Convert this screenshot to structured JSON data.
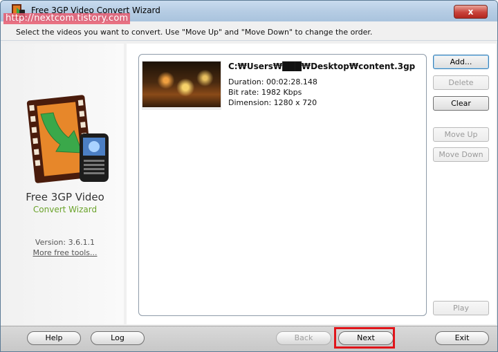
{
  "window": {
    "title": "Free 3GP Video Convert Wizard",
    "close_label": "x",
    "watermark": "http://nextcom.tistory.com"
  },
  "instruction": "Select the videos you want to convert. Use \"Move Up\" and \"Move Down\" to change the order.",
  "sidebar": {
    "brand_line1": "Free 3GP Video",
    "brand_line2": "Convert Wizard",
    "version": "Version: 3.6.1.1",
    "more_tools": "More free tools..."
  },
  "file_list": [
    {
      "path": "C:₩Users₩███₩Desktop₩content.3gp",
      "duration": "Duration: 00:02:28.148",
      "bitrate": "Bit rate: 1982 Kbps",
      "dimension": "Dimension: 1280 x 720"
    }
  ],
  "side_buttons": {
    "add": "Add...",
    "delete": "Delete",
    "clear": "Clear",
    "move_up": "Move Up",
    "move_down": "Move Down",
    "play": "Play"
  },
  "bottom_buttons": {
    "help": "Help",
    "log": "Log",
    "back": "Back",
    "next": "Next",
    "exit": "Exit"
  },
  "colors": {
    "brand_green": "#6aa32a",
    "highlight_red": "#e0141a"
  }
}
